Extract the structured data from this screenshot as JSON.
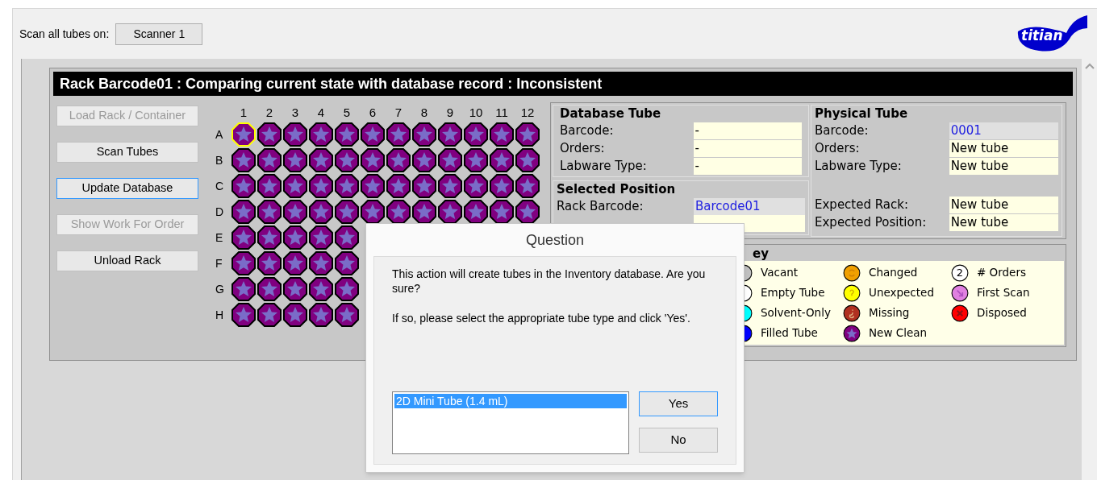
{
  "toolbar": {
    "label": "Scan all tubes on:",
    "scanner_button": "Scanner 1",
    "logo": "titian"
  },
  "rack": {
    "title": "Rack Barcode01 : Comparing current state with database record : Inconsistent",
    "buttons": [
      {
        "label": "Load Rack / Container",
        "disabled": true,
        "focused": false
      },
      {
        "label": "Scan Tubes",
        "disabled": false,
        "focused": false
      },
      {
        "label": "Update Database",
        "disabled": false,
        "focused": true
      },
      {
        "label": "Show Work For Order",
        "disabled": true,
        "focused": false
      },
      {
        "label": "Unload Rack",
        "disabled": false,
        "focused": false
      }
    ],
    "plate": {
      "columns": [
        "1",
        "2",
        "3",
        "4",
        "5",
        "6",
        "7",
        "8",
        "9",
        "10",
        "11",
        "12"
      ],
      "rows": [
        {
          "label": "A",
          "wells": [
            {
              "kind": "new_clean",
              "selected": true
            },
            {
              "kind": "new_clean",
              "selected": false
            },
            {
              "kind": "new_clean",
              "selected": false
            },
            {
              "kind": "new_clean",
              "selected": false
            },
            {
              "kind": "new_clean",
              "selected": false
            },
            {
              "kind": "new_clean",
              "selected": false
            },
            {
              "kind": "new_clean",
              "selected": false
            },
            {
              "kind": "new_clean",
              "selected": false
            },
            {
              "kind": "new_clean",
              "selected": false
            },
            {
              "kind": "new_clean",
              "selected": false
            },
            {
              "kind": "new_clean",
              "selected": false
            },
            {
              "kind": "new_clean",
              "selected": false
            }
          ]
        },
        {
          "label": "B",
          "wells": [
            {
              "kind": "new_clean",
              "selected": false
            },
            {
              "kind": "new_clean",
              "selected": false
            },
            {
              "kind": "new_clean",
              "selected": false
            },
            {
              "kind": "new_clean",
              "selected": false
            },
            {
              "kind": "new_clean",
              "selected": false
            },
            {
              "kind": "new_clean",
              "selected": false
            },
            {
              "kind": "new_clean",
              "selected": false
            },
            {
              "kind": "new_clean",
              "selected": false
            },
            {
              "kind": "new_clean",
              "selected": false
            },
            {
              "kind": "new_clean",
              "selected": false
            },
            {
              "kind": "new_clean",
              "selected": false
            },
            {
              "kind": "new_clean",
              "selected": false
            }
          ]
        },
        {
          "label": "C",
          "wells": [
            {
              "kind": "new_clean",
              "selected": false
            },
            {
              "kind": "new_clean",
              "selected": false
            },
            {
              "kind": "new_clean",
              "selected": false
            },
            {
              "kind": "new_clean",
              "selected": false
            },
            {
              "kind": "new_clean",
              "selected": false
            },
            {
              "kind": "new_clean",
              "selected": false
            },
            {
              "kind": "new_clean",
              "selected": false
            },
            {
              "kind": "new_clean",
              "selected": false
            },
            {
              "kind": "new_clean",
              "selected": false
            },
            {
              "kind": "new_clean",
              "selected": false
            },
            {
              "kind": "new_clean",
              "selected": false
            },
            {
              "kind": "new_clean",
              "selected": false
            }
          ]
        },
        {
          "label": "D",
          "wells": [
            {
              "kind": "new_clean",
              "selected": false
            },
            {
              "kind": "new_clean",
              "selected": false
            },
            {
              "kind": "new_clean",
              "selected": false
            },
            {
              "kind": "new_clean",
              "selected": false
            },
            {
              "kind": "new_clean",
              "selected": false
            },
            {
              "kind": "new_clean",
              "selected": false
            },
            {
              "kind": "new_clean",
              "selected": false
            },
            {
              "kind": "new_clean",
              "selected": false
            },
            {
              "kind": "new_clean",
              "selected": false
            },
            {
              "kind": "new_clean",
              "selected": false
            },
            {
              "kind": "new_clean",
              "selected": false
            },
            {
              "kind": "new_clean",
              "selected": false
            }
          ]
        },
        {
          "label": "E",
          "wells": [
            {
              "kind": "new_clean",
              "selected": false
            },
            {
              "kind": "new_clean",
              "selected": false
            },
            {
              "kind": "new_clean",
              "selected": false
            },
            {
              "kind": "new_clean",
              "selected": false
            },
            {
              "kind": "new_clean",
              "selected": false
            }
          ]
        },
        {
          "label": "F",
          "wells": [
            {
              "kind": "new_clean",
              "selected": false
            },
            {
              "kind": "new_clean",
              "selected": false
            },
            {
              "kind": "new_clean",
              "selected": false
            },
            {
              "kind": "new_clean",
              "selected": false
            },
            {
              "kind": "new_clean",
              "selected": false
            }
          ]
        },
        {
          "label": "G",
          "wells": [
            {
              "kind": "new_clean",
              "selected": false
            },
            {
              "kind": "new_clean",
              "selected": false
            },
            {
              "kind": "new_clean",
              "selected": false
            },
            {
              "kind": "new_clean",
              "selected": false
            },
            {
              "kind": "new_clean",
              "selected": false
            }
          ]
        },
        {
          "label": "H",
          "wells": [
            {
              "kind": "new_clean",
              "selected": false
            },
            {
              "kind": "new_clean",
              "selected": false
            },
            {
              "kind": "new_clean",
              "selected": false
            },
            {
              "kind": "new_clean",
              "selected": false
            },
            {
              "kind": "new_clean",
              "selected": false
            }
          ]
        }
      ]
    },
    "database_tube": {
      "title": "Database Tube",
      "fields": [
        {
          "label": "Barcode:",
          "value": "-",
          "link": false
        },
        {
          "label": "Orders:",
          "value": "-",
          "link": false
        },
        {
          "label": "Labware Type:",
          "value": "-",
          "link": false
        }
      ]
    },
    "physical_tube": {
      "title": "Physical Tube",
      "fields": [
        {
          "label": "Barcode:",
          "value": "0001",
          "link": true
        },
        {
          "label": "Orders:",
          "value": "New tube",
          "link": false
        },
        {
          "label": "Labware Type:",
          "value": "New tube",
          "link": false
        }
      ],
      "expected": [
        {
          "label": "Expected Rack:",
          "value": "New tube",
          "link": false
        },
        {
          "label": "Expected Position:",
          "value": "New tube",
          "link": false
        }
      ]
    },
    "selected_position": {
      "title": "Selected Position",
      "fields": [
        {
          "label": "Rack Barcode:",
          "value": "Barcode01",
          "link": true
        }
      ]
    },
    "key": {
      "title": "ey",
      "items": [
        {
          "label": "Vacant",
          "kind": "plain",
          "color": "#c0c0c0"
        },
        {
          "label": "Empty Tube",
          "kind": "plain",
          "color": "#ffffff"
        },
        {
          "label": "Solvent-Only",
          "kind": "plain",
          "color": "#00ffff"
        },
        {
          "label": "Filled Tube",
          "kind": "plain",
          "color": "#0000ff"
        },
        {
          "label": "Changed",
          "kind": "changed",
          "color": "#f0a000"
        },
        {
          "label": "Unexpected",
          "kind": "question",
          "color": "#ffff00"
        },
        {
          "label": "Missing",
          "kind": "missing",
          "color": "#b03020"
        },
        {
          "label": "New Clean",
          "kind": "star",
          "color": "#800080"
        },
        {
          "label": "# Orders",
          "kind": "count",
          "color": "#ffffff",
          "glyph": "2"
        },
        {
          "label": "First Scan",
          "kind": "arrow",
          "color": "#e080e0"
        },
        {
          "label": "Disposed",
          "kind": "cross",
          "color": "#ff0000"
        }
      ]
    }
  },
  "dialog": {
    "title": "Question",
    "message": "This action will create tubes in the Inventory database. Are you sure?",
    "instruction": "If so, please select the appropriate tube type and click 'Yes'.",
    "options": [
      {
        "label": "2D Mini Tube (1.4 mL)",
        "selected": true
      }
    ],
    "buttons": [
      {
        "label": "Yes",
        "focused": true
      },
      {
        "label": "No",
        "focused": false
      }
    ]
  }
}
